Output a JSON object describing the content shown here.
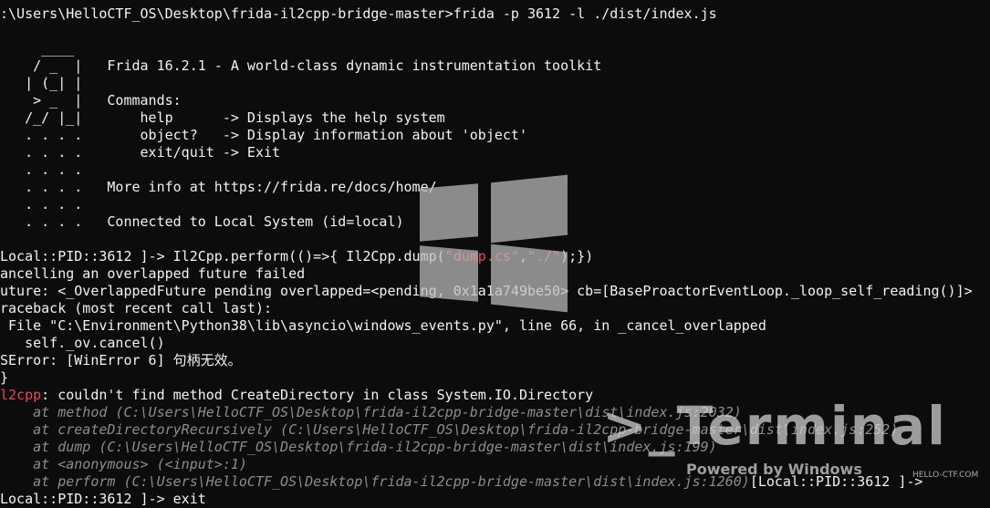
{
  "terminal": {
    "lines": [
      {
        "segments": [
          {
            "text": ":\\Users\\HelloCTF_OS\\Desktop\\frida-il2cpp-bridge-master>frida -p 3612 -l ./dist/index.js",
            "style": "white"
          }
        ]
      },
      {
        "segments": [
          {
            "text": "     ____",
            "style": "white"
          }
        ]
      },
      {
        "segments": [
          {
            "text": "    / _  |   Frida 16.2.1 - A world-class dynamic instrumentation toolkit",
            "style": "white"
          }
        ]
      },
      {
        "segments": [
          {
            "text": "   | (_| |",
            "style": "white"
          }
        ]
      },
      {
        "segments": [
          {
            "text": "    > _  |   Commands:",
            "style": "white"
          }
        ]
      },
      {
        "segments": [
          {
            "text": "   /_/ |_|       help      -> Displays the help system",
            "style": "white"
          }
        ]
      },
      {
        "segments": [
          {
            "text": "   . . . .       object?   -> Display information about 'object'",
            "style": "white"
          }
        ]
      },
      {
        "segments": [
          {
            "text": "   . . . .       exit/quit -> Exit",
            "style": "white"
          }
        ]
      },
      {
        "segments": [
          {
            "text": "   . . . .",
            "style": "white"
          }
        ]
      },
      {
        "segments": [
          {
            "text": "   . . . .   More info at https://frida.re/docs/home/",
            "style": "white"
          }
        ]
      },
      {
        "segments": [
          {
            "text": "   . . . .",
            "style": "white"
          }
        ]
      },
      {
        "segments": [
          {
            "text": "   . . . .   Connected to Local System (id=local)",
            "style": "white"
          }
        ]
      },
      {
        "segments": [
          {
            "text": "",
            "style": "white"
          }
        ]
      },
      {
        "segments": [
          {
            "text": "Local::PID::3612 ]-> Il2Cpp.perform(()=>{ Il2Cpp.dump(",
            "style": "white"
          },
          {
            "text": "\"dump.cs\"",
            "style": "red"
          },
          {
            "text": ",",
            "style": "white"
          },
          {
            "text": "\"./\"",
            "style": "red"
          },
          {
            "text": ");})",
            "style": "white"
          }
        ]
      },
      {
        "segments": [
          {
            "text": "ancelling an overlapped future failed",
            "style": "white"
          }
        ]
      },
      {
        "segments": [
          {
            "text": "uture: <_OverlappedFuture pending overlapped=<pending, 0x1a1a749be50> cb=[BaseProactorEventLoop._loop_self_reading()]>",
            "style": "white"
          }
        ]
      },
      {
        "segments": [
          {
            "text": "raceback (most recent call last):",
            "style": "white"
          }
        ]
      },
      {
        "segments": [
          {
            "text": " File \"C:\\Environment\\Python38\\lib\\asyncio\\windows_events.py\", line 66, in _cancel_overlapped",
            "style": "white"
          }
        ]
      },
      {
        "segments": [
          {
            "text": "   self._ov.cancel()",
            "style": "white"
          }
        ]
      },
      {
        "segments": [
          {
            "text": "SError: [WinError 6] 句柄无效。",
            "style": "white"
          }
        ]
      },
      {
        "segments": [
          {
            "text": "}",
            "style": "white"
          }
        ]
      },
      {
        "segments": [
          {
            "text": "l2cpp",
            "style": "red"
          },
          {
            "text": ": couldn't find method CreateDirectory in class System.IO.Directory",
            "style": "white"
          }
        ]
      },
      {
        "segments": [
          {
            "text": "    at method (C:\\Users\\HelloCTF_OS\\Desktop\\frida-il2cpp-bridge-master\\dist\\index.js:2032)",
            "style": "gray"
          }
        ]
      },
      {
        "segments": [
          {
            "text": "    at createDirectoryRecursively (C:\\Users\\HelloCTF_OS\\Desktop\\frida-il2cpp-bridge-master\\dist\\index.js:252)",
            "style": "gray"
          }
        ]
      },
      {
        "segments": [
          {
            "text": "    at dump (C:\\Users\\HelloCTF_OS\\Desktop\\frida-il2cpp-bridge-master\\dist\\index.js:199)",
            "style": "gray"
          }
        ]
      },
      {
        "segments": [
          {
            "text": "    at <anonymous> (<input>:1)",
            "style": "gray"
          }
        ]
      },
      {
        "segments": [
          {
            "text": "    at perform (C:\\Users\\HelloCTF_OS\\Desktop\\frida-il2cpp-bridge-master\\dist\\index.js:1260)",
            "style": "gray"
          },
          {
            "text": "[Local::PID::3612 ]->",
            "style": "white"
          }
        ]
      },
      {
        "segments": [
          {
            "text": "Local::PID::3612 ]-> exit",
            "style": "white"
          }
        ]
      }
    ]
  },
  "watermark": {
    "title": ">_Terminal",
    "powered": "Powered by Windows",
    "site": "HELLO-CTF.COM"
  },
  "colors": {
    "background": "#0c0c0c",
    "text": "#e6e6e6",
    "red": "#e74856",
    "gray": "#8c8c8c"
  }
}
